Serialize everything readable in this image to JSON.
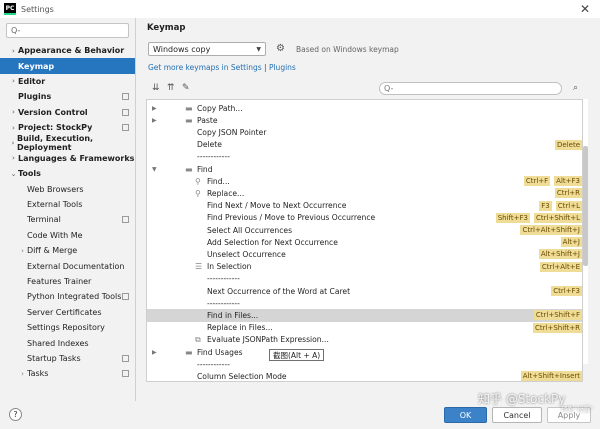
{
  "window": {
    "title": "Settings",
    "app_icon": "PC"
  },
  "sidebar": {
    "search_placeholder": "Q-",
    "items": [
      {
        "label": "Appearance & Behavior",
        "indent": 0,
        "arrow": "›",
        "bold": true,
        "selected": false,
        "project": false
      },
      {
        "label": "Keymap",
        "indent": 0,
        "arrow": "",
        "bold": true,
        "selected": true,
        "project": false
      },
      {
        "label": "Editor",
        "indent": 0,
        "arrow": "›",
        "bold": true,
        "selected": false,
        "project": false
      },
      {
        "label": "Plugins",
        "indent": 0,
        "arrow": "",
        "bold": true,
        "selected": false,
        "project": true
      },
      {
        "label": "Version Control",
        "indent": 0,
        "arrow": "›",
        "bold": true,
        "selected": false,
        "project": true
      },
      {
        "label": "Project: StockPy",
        "indent": 0,
        "arrow": "›",
        "bold": true,
        "selected": false,
        "project": true
      },
      {
        "label": "Build, Execution, Deployment",
        "indent": 0,
        "arrow": "›",
        "bold": true,
        "selected": false,
        "project": false
      },
      {
        "label": "Languages & Frameworks",
        "indent": 0,
        "arrow": "›",
        "bold": true,
        "selected": false,
        "project": false
      },
      {
        "label": "Tools",
        "indent": 0,
        "arrow": "⌄",
        "bold": true,
        "selected": false,
        "project": false
      },
      {
        "label": "Web Browsers",
        "indent": 1,
        "arrow": "",
        "bold": false,
        "selected": false,
        "project": false
      },
      {
        "label": "External Tools",
        "indent": 1,
        "arrow": "",
        "bold": false,
        "selected": false,
        "project": false
      },
      {
        "label": "Terminal",
        "indent": 1,
        "arrow": "",
        "bold": false,
        "selected": false,
        "project": true
      },
      {
        "label": "Code With Me",
        "indent": 1,
        "arrow": "",
        "bold": false,
        "selected": false,
        "project": false
      },
      {
        "label": "Diff & Merge",
        "indent": 1,
        "arrow": "›",
        "bold": false,
        "selected": false,
        "project": false
      },
      {
        "label": "External Documentation",
        "indent": 1,
        "arrow": "",
        "bold": false,
        "selected": false,
        "project": false
      },
      {
        "label": "Features Trainer",
        "indent": 1,
        "arrow": "",
        "bold": false,
        "selected": false,
        "project": false
      },
      {
        "label": "Python Integrated Tools",
        "indent": 1,
        "arrow": "",
        "bold": false,
        "selected": false,
        "project": true
      },
      {
        "label": "Server Certificates",
        "indent": 1,
        "arrow": "",
        "bold": false,
        "selected": false,
        "project": false
      },
      {
        "label": "Settings Repository",
        "indent": 1,
        "arrow": "",
        "bold": false,
        "selected": false,
        "project": false
      },
      {
        "label": "Shared Indexes",
        "indent": 1,
        "arrow": "",
        "bold": false,
        "selected": false,
        "project": false
      },
      {
        "label": "Startup Tasks",
        "indent": 1,
        "arrow": "",
        "bold": false,
        "selected": false,
        "project": true
      },
      {
        "label": "Tasks",
        "indent": 1,
        "arrow": "›",
        "bold": false,
        "selected": false,
        "project": true
      }
    ]
  },
  "main": {
    "title": "Keymap",
    "keymap_value": "Windows copy",
    "based_on": "Based on Windows keymap",
    "link_prefix": "Get more keymaps in Settings",
    "link_sep": "|",
    "link_plugins": "Plugins",
    "find_placeholder": "Q-"
  },
  "actions": [
    {
      "label": "Copy Path...",
      "level": 1,
      "arrow": "›",
      "icon": "folder",
      "shortcuts": [],
      "selected": false
    },
    {
      "label": "Paste",
      "level": 1,
      "arrow": "›",
      "icon": "folder",
      "shortcuts": [],
      "selected": false
    },
    {
      "label": "Copy JSON Pointer",
      "level": 1,
      "arrow": "",
      "icon": "",
      "shortcuts": [],
      "selected": false
    },
    {
      "label": "Delete",
      "level": 1,
      "arrow": "",
      "icon": "",
      "shortcuts": [
        "Delete"
      ],
      "selected": false
    },
    {
      "label": "------------",
      "level": 1,
      "arrow": "",
      "icon": "",
      "shortcuts": [],
      "selected": false
    },
    {
      "label": "Find",
      "level": 1,
      "arrow": "⌄",
      "icon": "folder",
      "shortcuts": [],
      "selected": false
    },
    {
      "label": "Find...",
      "level": 2,
      "arrow": "",
      "icon": "search",
      "shortcuts": [
        "Ctrl+F",
        "Alt+F3"
      ],
      "selected": false
    },
    {
      "label": "Replace...",
      "level": 2,
      "arrow": "",
      "icon": "replace",
      "shortcuts": [
        "Ctrl+R"
      ],
      "selected": false
    },
    {
      "label": "Find Next / Move to Next Occurrence",
      "level": 2,
      "arrow": "",
      "icon": "",
      "shortcuts": [
        "F3",
        "Ctrl+L"
      ],
      "selected": false
    },
    {
      "label": "Find Previous / Move to Previous Occurrence",
      "level": 2,
      "arrow": "",
      "icon": "",
      "shortcuts": [
        "Shift+F3",
        "Ctrl+Shift+L"
      ],
      "selected": false
    },
    {
      "label": "Select All Occurrences",
      "level": 2,
      "arrow": "",
      "icon": "",
      "shortcuts": [
        "Ctrl+Alt+Shift+J"
      ],
      "selected": false
    },
    {
      "label": "Add Selection for Next Occurrence",
      "level": 2,
      "arrow": "",
      "icon": "",
      "shortcuts": [
        "Alt+J"
      ],
      "selected": false
    },
    {
      "label": "Unselect Occurrence",
      "level": 2,
      "arrow": "",
      "icon": "",
      "shortcuts": [
        "Alt+Shift+J"
      ],
      "selected": false
    },
    {
      "label": "In Selection",
      "level": 2,
      "arrow": "",
      "icon": "selection",
      "shortcuts": [
        "Ctrl+Alt+E"
      ],
      "selected": false
    },
    {
      "label": "------------",
      "level": 2,
      "arrow": "",
      "icon": "",
      "shortcuts": [],
      "selected": false
    },
    {
      "label": "Next Occurrence of the Word at Caret",
      "level": 2,
      "arrow": "",
      "icon": "",
      "shortcuts": [
        "Ctrl+F3"
      ],
      "selected": false
    },
    {
      "label": "------------",
      "level": 2,
      "arrow": "",
      "icon": "",
      "shortcuts": [],
      "selected": false
    },
    {
      "label": "Find in Files...",
      "level": 2,
      "arrow": "",
      "icon": "",
      "shortcuts": [
        "Ctrl+Shift+F"
      ],
      "selected": true
    },
    {
      "label": "Replace in Files...",
      "level": 2,
      "arrow": "",
      "icon": "",
      "shortcuts": [
        "Ctrl+Shift+R"
      ],
      "selected": false
    },
    {
      "label": "Evaluate JSONPath Expression...",
      "level": 2,
      "arrow": "",
      "icon": "json",
      "shortcuts": [],
      "selected": false
    },
    {
      "label": "Find Usages",
      "level": 1,
      "arrow": "›",
      "icon": "folder",
      "shortcuts": [],
      "selected": false
    },
    {
      "label": "------------",
      "level": 1,
      "arrow": "",
      "icon": "",
      "shortcuts": [],
      "selected": false
    },
    {
      "label": "Column Selection Mode",
      "level": 1,
      "arrow": "",
      "icon": "",
      "shortcuts": [
        "Alt+Shift+Insert"
      ],
      "selected": false
    }
  ],
  "tooltip": "截图(Alt + A)",
  "buttons": {
    "ok": "OK",
    "cancel": "Cancel",
    "apply": "Apply",
    "help": "?"
  },
  "watermark": "知乎 @StockPy",
  "watermark_small": "转到\"设置\""
}
